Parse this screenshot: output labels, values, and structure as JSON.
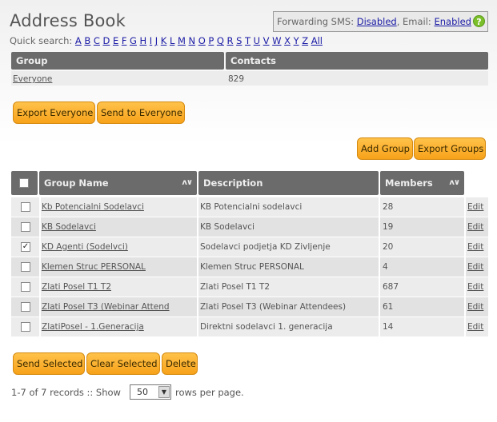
{
  "page": {
    "title": "Address Book"
  },
  "forwarding": {
    "sms_label": "Forwarding SMS:",
    "sms_value": "Disabled",
    "separator": ",",
    "email_label": "Email:",
    "email_value": "Enabled",
    "help_icon": "question-icon"
  },
  "quick_search": {
    "label": "Quick search:",
    "letters": [
      "A",
      "B",
      "C",
      "D",
      "E",
      "F",
      "G",
      "H",
      "I",
      "J",
      "K",
      "L",
      "M",
      "N",
      "O",
      "P",
      "Q",
      "R",
      "S",
      "T",
      "U",
      "V",
      "W",
      "X",
      "Y",
      "Z",
      "All"
    ]
  },
  "summary": {
    "headers": {
      "group": "Group",
      "contacts": "Contacts"
    },
    "group": "Everyone",
    "contacts": "829"
  },
  "summary_buttons": {
    "export_everyone": "Export Everyone",
    "send_everyone": "Send to Everyone"
  },
  "group_buttons": {
    "add_group": "Add Group",
    "export_groups": "Export Groups"
  },
  "table": {
    "headers": {
      "group_name": "Group Name",
      "description": "Description",
      "members": "Members",
      "sort_icon": "ʌ∨"
    },
    "edit_label": "Edit",
    "rows": [
      {
        "name": "Kb Potencialni Sodelavci",
        "description": "KB Potencialni sodelavci",
        "members": "28",
        "checked": false
      },
      {
        "name": "KB Sodelavci",
        "description": "KB Sodelavci",
        "members": "19",
        "checked": false
      },
      {
        "name": "KD Agenti (Sodelvci)",
        "description": "Sodelavci podjetja KD Zivljenje",
        "members": "20",
        "checked": true
      },
      {
        "name": "Klemen Struc PERSONAL",
        "description": "Klemen Struc PERSONAL",
        "members": "4",
        "checked": false
      },
      {
        "name": "Zlati Posel T1 T2",
        "description": "Zlati Posel T1 T2",
        "members": "687",
        "checked": false
      },
      {
        "name": "Zlati Posel T3 (Webinar Attend",
        "description": "Zlati Posel T3 (Webinar Attendees)",
        "members": "61",
        "checked": false
      },
      {
        "name": "ZlatiPosel - 1.Generacija",
        "description": "Direktni sodelavci 1. generacija",
        "members": "14",
        "checked": false
      }
    ]
  },
  "action_buttons": {
    "send_selected": "Send Selected",
    "clear_selected": "Clear Selected",
    "delete": "Delete"
  },
  "footer": {
    "records": "1-7 of 7 records :: Show",
    "per_page_value": "50",
    "suffix": "rows per page."
  },
  "colors": {
    "button": "#f7a21a",
    "header": "#6b6b6b",
    "link": "#1a1aa6",
    "help": "#7bbf2a"
  }
}
